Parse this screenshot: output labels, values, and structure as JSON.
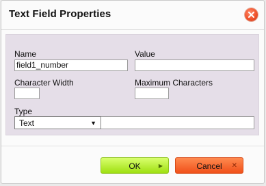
{
  "dialog": {
    "title": "Text Field Properties",
    "close_icon": "close-icon"
  },
  "form": {
    "name_label": "Name",
    "name_value": "field1_number",
    "value_label": "Value",
    "value_value": "",
    "char_width_label": "Character Width",
    "char_width_value": "",
    "max_chars_label": "Maximum Characters",
    "max_chars_value": "",
    "type_label": "Type",
    "type_selected": "Text",
    "type_caret": "▼"
  },
  "buttons": {
    "ok_label": "OK",
    "ok_icon": "▶",
    "cancel_label": "Cancel",
    "cancel_icon": "✕"
  },
  "colors": {
    "content_bg": "#e5dee8",
    "ok_bg": "#a6e21c",
    "cancel_bg": "#f2541e"
  }
}
